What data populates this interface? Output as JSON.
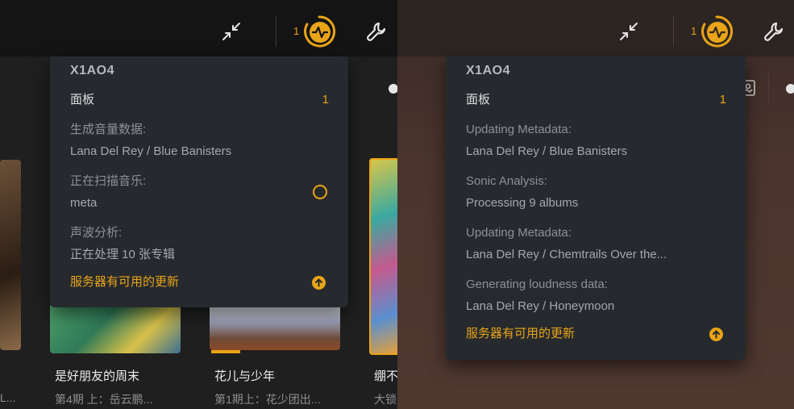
{
  "topbar": {
    "exit_fullscreen_icon": "compress-arrows-icon",
    "activity_count": "1",
    "activity_icon": "activity-pulse-icon",
    "settings_icon": "wrench-icon"
  },
  "left_menu": {
    "server_name": "X1AO4",
    "panel_label": "面板",
    "panel_value": "1",
    "tasks": [
      {
        "label": "生成音量数据:",
        "detail": "Lana Del Rey / Blue Banisters",
        "spinning": false
      },
      {
        "label": "正在扫描音乐:",
        "detail": "meta",
        "spinning": true
      },
      {
        "label": "声波分析:",
        "detail": "正在处理 10 张专辑",
        "spinning": false
      }
    ],
    "update_label": "服务器有可用的更新"
  },
  "right_menu": {
    "server_name": "X1AO4",
    "panel_label": "面板",
    "panel_value": "1",
    "tasks": [
      {
        "label": "Updating Metadata:",
        "detail": "Lana Del Rey / Blue Banisters"
      },
      {
        "label": "Sonic Analysis:",
        "detail": "Processing 9 albums"
      },
      {
        "label": "Updating Metadata:",
        "detail": "Lana Del Rey / Chemtrails Over the..."
      },
      {
        "label": "Generating loudness data:",
        "detail": "Lana Del Rey / Honeymoon"
      }
    ],
    "update_label": "服务器有可用的更新"
  },
  "albums": [
    {
      "title": "是好朋友的周末",
      "subtitle": "第4期 上：岳云鹏..."
    },
    {
      "title": "花儿与少年",
      "subtitle": "第1期上：花少团出..."
    },
    {
      "title": "绷不",
      "subtitle": "大锁"
    }
  ],
  "left_edge_subtitle": "L...",
  "colors": {
    "accent": "#e9a417",
    "menu_bg": "#262a2e"
  }
}
